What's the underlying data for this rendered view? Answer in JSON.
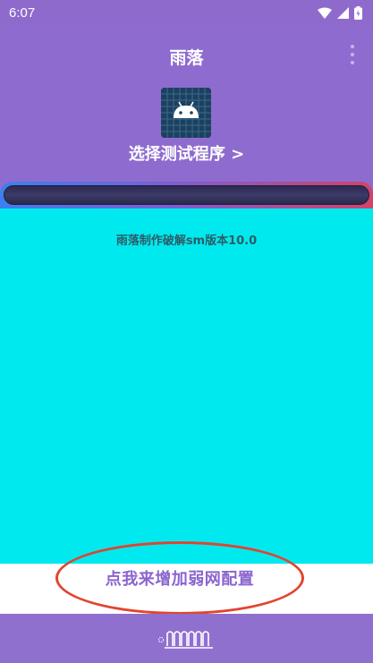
{
  "status_bar": {
    "time": "6:07",
    "icons": [
      "wifi-icon",
      "signal-icon",
      "battery-icon"
    ]
  },
  "app_bar": {
    "title": "雨落",
    "menu_icon": "overflow-menu-icon"
  },
  "target": {
    "icon": "android-icon",
    "select_label": "选择测试程序 >"
  },
  "progress": {
    "fraction": 0
  },
  "content": {
    "version_text": "雨落制作破解sm版本10.0"
  },
  "config": {
    "label": "点我来增加弱网配置"
  },
  "bottom_bar": {
    "logo_icon": "coil-logo-icon"
  },
  "colors": {
    "primary": "#8e6ccf",
    "content_bg": "#00e9ef",
    "annotation_red": "#e2442f",
    "config_text": "#8b64cf"
  }
}
